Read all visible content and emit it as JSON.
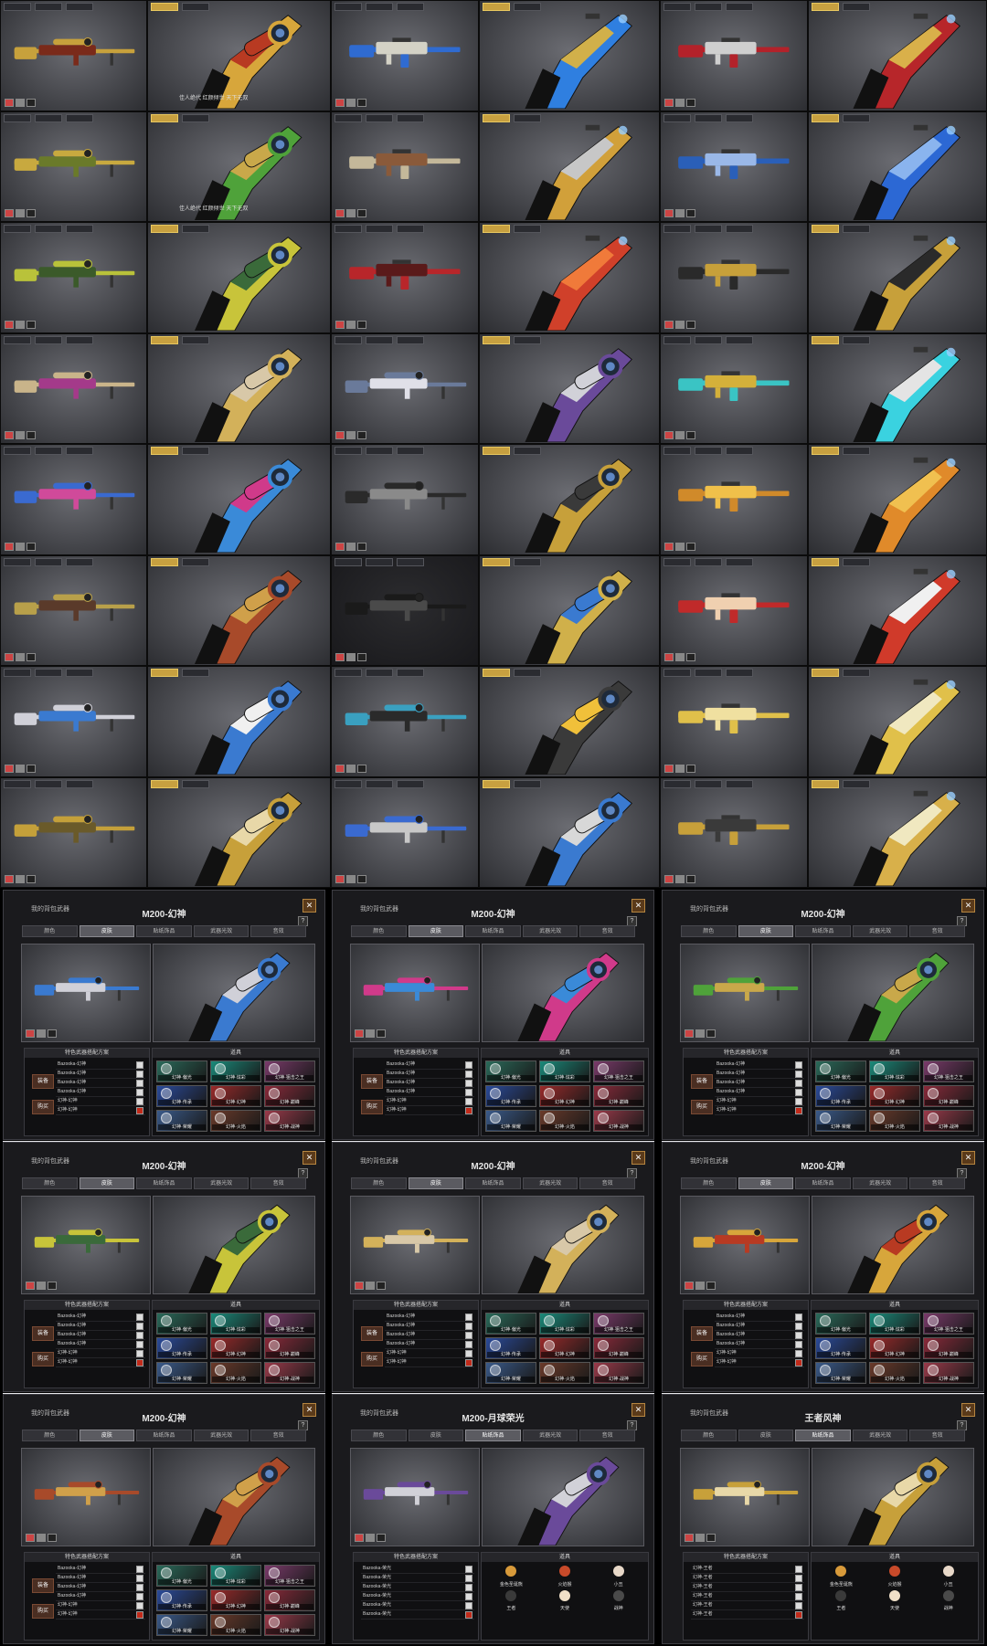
{
  "grid": {
    "cells": [
      {
        "view": "side",
        "mode": "ui",
        "c1": "#c7a13c",
        "c2": "#7a2a1a",
        "kind": "sniper",
        "tone": "light"
      },
      {
        "view": "fpv",
        "c1": "#d7a63b",
        "c2": "#b83a22",
        "kind": "sniper",
        "tone": "light",
        "caption": "佳人绝代 红颜倾世 天下无双"
      },
      {
        "view": "side",
        "mode": "ui",
        "c1": "#2f6bd1",
        "c2": "#d4d2c6",
        "kind": "rifle",
        "tone": "light"
      },
      {
        "view": "fpv",
        "c1": "#2f7fe0",
        "c2": "#d1b04a",
        "kind": "rifle",
        "tone": "light"
      },
      {
        "view": "side",
        "mode": "ui",
        "c1": "#b3222a",
        "c2": "#cfcfcf",
        "kind": "rifle",
        "tone": "light"
      },
      {
        "view": "fpv",
        "c1": "#b7262a",
        "c2": "#d9b04a",
        "kind": "rifle",
        "tone": "light"
      },
      {
        "view": "side",
        "mode": "ui",
        "c1": "#c8a93f",
        "c2": "#6a7a2a",
        "kind": "sniper",
        "tone": "light"
      },
      {
        "view": "fpv",
        "c1": "#4fa23a",
        "c2": "#c9a84a",
        "kind": "sniper",
        "tone": "light",
        "caption": "佳人绝代 红颜倾世 天下无双"
      },
      {
        "view": "side",
        "mode": "ui",
        "c1": "#c4b89a",
        "c2": "#8a5a3a",
        "kind": "rifle",
        "tone": "light"
      },
      {
        "view": "fpv",
        "c1": "#d1a03a",
        "c2": "#c7c7c7",
        "kind": "rifle",
        "tone": "light"
      },
      {
        "view": "side",
        "mode": "ui",
        "c1": "#2a5fb8",
        "c2": "#9ab8e8",
        "kind": "rifle",
        "tone": "light"
      },
      {
        "view": "fpv",
        "c1": "#2c68d4",
        "c2": "#8ab4ee",
        "kind": "rifle",
        "tone": "light"
      },
      {
        "view": "side",
        "mode": "ui",
        "c1": "#b9c23a",
        "c2": "#3b5a2a",
        "kind": "sniper",
        "tone": "light"
      },
      {
        "view": "fpv",
        "c1": "#c8c43a",
        "c2": "#3a6a3a",
        "kind": "sniper",
        "tone": "light"
      },
      {
        "view": "side",
        "mode": "ui",
        "c1": "#b8262a",
        "c2": "#5a1a1a",
        "kind": "rifle",
        "tone": "light"
      },
      {
        "view": "fpv",
        "c1": "#d0402a",
        "c2": "#f07a3a",
        "kind": "rifle",
        "tone": "light"
      },
      {
        "view": "side",
        "mode": "ui",
        "c1": "#2a2a2a",
        "c2": "#c7a03a",
        "kind": "rifle",
        "tone": "light"
      },
      {
        "view": "fpv",
        "c1": "#c7a03a",
        "c2": "#2a2a2a",
        "kind": "rifle",
        "tone": "light"
      },
      {
        "view": "side",
        "mode": "ui",
        "c1": "#c9b48a",
        "c2": "#a43a8a",
        "kind": "sniper",
        "tone": "light"
      },
      {
        "view": "fpv",
        "c1": "#d3b15a",
        "c2": "#d8c8a8",
        "kind": "sniper",
        "tone": "light"
      },
      {
        "view": "side",
        "mode": "ui",
        "c1": "#6a7a9a",
        "c2": "#e0e0e8",
        "kind": "sniper",
        "tone": "light"
      },
      {
        "view": "fpv",
        "c1": "#6a4a9a",
        "c2": "#d1d1d8",
        "kind": "sniper",
        "tone": "light"
      },
      {
        "view": "side",
        "mode": "ui",
        "c1": "#3ac4c4",
        "c2": "#d4b03a",
        "kind": "rifle",
        "tone": "light"
      },
      {
        "view": "fpv",
        "c1": "#3ad2e0",
        "c2": "#e4e4e4",
        "kind": "rifle",
        "tone": "light"
      },
      {
        "view": "side",
        "mode": "ui",
        "c1": "#3a6ad0",
        "c2": "#d04a9a",
        "kind": "sniper",
        "tone": "light"
      },
      {
        "view": "fpv",
        "c1": "#3a8ad8",
        "c2": "#d03a8a",
        "kind": "sniper",
        "tone": "light"
      },
      {
        "view": "side",
        "mode": "ui",
        "c1": "#2a2a2a",
        "c2": "#8a8a8a",
        "kind": "sniper",
        "tone": "light"
      },
      {
        "view": "fpv",
        "c1": "#c7a03a",
        "c2": "#3a3a3a",
        "kind": "sniper",
        "tone": "light"
      },
      {
        "view": "side",
        "mode": "ui",
        "c1": "#d08a2a",
        "c2": "#f0c04a",
        "kind": "rifle",
        "tone": "light"
      },
      {
        "view": "fpv",
        "c1": "#e08a2a",
        "c2": "#f0c050",
        "kind": "rifle",
        "tone": "light"
      },
      {
        "view": "side",
        "mode": "ui",
        "c1": "#b8a04a",
        "c2": "#5a3a2a",
        "kind": "sniper",
        "tone": "light"
      },
      {
        "view": "fpv",
        "c1": "#a84a2a",
        "c2": "#d0a04a",
        "kind": "sniper",
        "tone": "light"
      },
      {
        "view": "side",
        "mode": "ui",
        "c1": "#1a1a1a",
        "c2": "#4a4a4a",
        "kind": "sniper",
        "tone": "dark"
      },
      {
        "view": "fpv",
        "c1": "#d0b04a",
        "c2": "#3a7ad0",
        "kind": "sniper",
        "tone": "light"
      },
      {
        "view": "side",
        "mode": "ui",
        "c1": "#c02a2a",
        "c2": "#f0d0b0",
        "kind": "rifle",
        "tone": "light"
      },
      {
        "view": "fpv",
        "c1": "#d03a2a",
        "c2": "#f0f0f0",
        "kind": "rifle",
        "tone": "light"
      },
      {
        "view": "side",
        "mode": "ui",
        "c1": "#d0d0d8",
        "c2": "#3a7ad0",
        "kind": "sniper",
        "tone": "light"
      },
      {
        "view": "fpv",
        "c1": "#3a7ad0",
        "c2": "#f0f0f0",
        "kind": "sniper",
        "tone": "light"
      },
      {
        "view": "side",
        "mode": "ui",
        "c1": "#3aa0c0",
        "c2": "#2a2a2a",
        "kind": "sniper",
        "tone": "light"
      },
      {
        "view": "fpv",
        "c1": "#3a3a3a",
        "c2": "#f0c03a",
        "kind": "sniper",
        "tone": "light"
      },
      {
        "view": "side",
        "mode": "ui",
        "c1": "#e0c04a",
        "c2": "#f0e0a0",
        "kind": "rifle",
        "tone": "light"
      },
      {
        "view": "fpv",
        "c1": "#e0c04a",
        "c2": "#f0e8c0",
        "kind": "rifle",
        "tone": "light"
      },
      {
        "view": "side",
        "mode": "ui",
        "c1": "#c4a03a",
        "c2": "#6a5a2a",
        "kind": "sniper",
        "tone": "light"
      },
      {
        "view": "fpv",
        "c1": "#c7a03a",
        "c2": "#e8d8a8",
        "kind": "sniper",
        "tone": "light"
      },
      {
        "view": "side",
        "mode": "ui",
        "c1": "#3a6ad0",
        "c2": "#c8c8c8",
        "kind": "sniper",
        "tone": "light"
      },
      {
        "view": "fpv",
        "c1": "#3a7ad0",
        "c2": "#d8d8d8",
        "kind": "sniper",
        "tone": "light"
      },
      {
        "view": "side",
        "mode": "ui",
        "c1": "#c7a03a",
        "c2": "#3a3a3a",
        "kind": "rifle",
        "tone": "light"
      },
      {
        "view": "fpv",
        "c1": "#d8b04a",
        "c2": "#f0e8c0",
        "kind": "rifle",
        "tone": "light"
      }
    ]
  },
  "windows": [
    {
      "title": "M200-幻神",
      "sub": "我的背包武器",
      "tabs": [
        "颜色",
        "皮肤",
        "贴纸饰品",
        "武器光效",
        "音效"
      ],
      "active_tab": 1,
      "left_header": "特色武器搭配方案",
      "right_header": "道具",
      "left_btn1": "装备",
      "left_btn2": "购买",
      "rows": [
        "Bazooka-幻神",
        "Bazooka-幻神",
        "Bazooka-幻神",
        "Bazooka-幻神",
        "幻神-幻神",
        "幻神-幻神"
      ],
      "save": "保存",
      "cancel": "取消",
      "mode": "sprays",
      "c1": "#3a7ad0",
      "c2": "#d0d0d8"
    },
    {
      "title": "M200-幻神",
      "sub": "我的背包武器",
      "tabs": [
        "颜色",
        "皮肤",
        "贴纸饰品",
        "武器光效",
        "音效"
      ],
      "active_tab": 1,
      "left_header": "特色武器搭配方案",
      "right_header": "道具",
      "left_btn1": "装备",
      "left_btn2": "购买",
      "rows": [
        "Bazooka-幻神",
        "Bazooka-幻神",
        "Bazooka-幻神",
        "Bazooka-幻神",
        "幻神-幻神",
        "幻神-幻神"
      ],
      "save": "保存",
      "cancel": "取消",
      "mode": "sprays",
      "c1": "#d03a8a",
      "c2": "#3a8ad8"
    },
    {
      "title": "M200-幻神",
      "sub": "我的背包武器",
      "tabs": [
        "颜色",
        "皮肤",
        "贴纸饰品",
        "武器光效",
        "音效"
      ],
      "active_tab": 1,
      "left_header": "特色武器搭配方案",
      "right_header": "道具",
      "left_btn1": "装备",
      "left_btn2": "购买",
      "rows": [
        "Bazooka-幻神",
        "Bazooka-幻神",
        "Bazooka-幻神",
        "Bazooka-幻神",
        "幻神-幻神",
        "幻神-幻神"
      ],
      "save": "保存",
      "cancel": "取消",
      "mode": "sprays",
      "c1": "#4fa23a",
      "c2": "#c9a84a"
    },
    {
      "title": "M200-幻神",
      "sub": "我的背包武器",
      "tabs": [
        "颜色",
        "皮肤",
        "贴纸饰品",
        "武器光效",
        "音效"
      ],
      "active_tab": 1,
      "left_header": "特色武器搭配方案",
      "right_header": "道具",
      "left_btn1": "装备",
      "left_btn2": "购买",
      "rows": [
        "Bazooka-幻神",
        "Bazooka-幻神",
        "Bazooka-幻神",
        "Bazooka-幻神",
        "幻神-幻神",
        "幻神-幻神"
      ],
      "save": "保存",
      "cancel": "取消",
      "mode": "sprays",
      "c1": "#c8c43a",
      "c2": "#3a6a3a"
    },
    {
      "title": "M200-幻神",
      "sub": "我的背包武器",
      "tabs": [
        "颜色",
        "皮肤",
        "贴纸饰品",
        "武器光效",
        "音效"
      ],
      "active_tab": 1,
      "left_header": "特色武器搭配方案",
      "right_header": "道具",
      "left_btn1": "装备",
      "left_btn2": "购买",
      "rows": [
        "Bazooka-幻神",
        "Bazooka-幻神",
        "Bazooka-幻神",
        "Bazooka-幻神",
        "幻神-幻神",
        "幻神-幻神"
      ],
      "save": "保存",
      "cancel": "取消",
      "mode": "sprays",
      "c1": "#d3b15a",
      "c2": "#d8c8a8"
    },
    {
      "title": "M200-幻神",
      "sub": "我的背包武器",
      "tabs": [
        "颜色",
        "皮肤",
        "贴纸饰品",
        "武器光效",
        "音效"
      ],
      "active_tab": 1,
      "left_header": "特色武器搭配方案",
      "right_header": "道具",
      "left_btn1": "装备",
      "left_btn2": "购买",
      "rows": [
        "Bazooka-幻神",
        "Bazooka-幻神",
        "Bazooka-幻神",
        "Bazooka-幻神",
        "幻神-幻神",
        "幻神-幻神"
      ],
      "save": "保存",
      "cancel": "取消",
      "mode": "sprays",
      "c1": "#d7a63b",
      "c2": "#b83a22"
    },
    {
      "title": "M200-幻神",
      "sub": "我的背包武器",
      "tabs": [
        "颜色",
        "皮肤",
        "贴纸饰品",
        "武器光效",
        "音效"
      ],
      "active_tab": 1,
      "left_header": "特色武器搭配方案",
      "right_header": "道具",
      "left_btn1": "装备",
      "left_btn2": "购买",
      "rows": [
        "Bazooka-幻神",
        "Bazooka-幻神",
        "Bazooka-幻神",
        "Bazooka-幻神",
        "幻神-幻神",
        "幻神-幻神"
      ],
      "save": "保存",
      "cancel": "取消",
      "mode": "sprays",
      "c1": "#a84a2a",
      "c2": "#d0a04a"
    },
    {
      "title": "M200-月球荣光",
      "sub": "我的背包武器",
      "tabs": [
        "颜色",
        "皮肤",
        "贴纸饰品",
        "武器光效",
        "音效"
      ],
      "active_tab": 2,
      "left_header": "特色武器搭配方案",
      "right_header": "道具",
      "left_btn1": "",
      "left_btn2": "",
      "rows": [
        "Bazooka-荣光",
        "Bazooka-荣光",
        "Bazooka-荣光",
        "Bazooka-荣光",
        "Bazooka-荣光",
        "Bazooka-荣光"
      ],
      "save": "保存",
      "cancel": "取消",
      "mode": "charms",
      "c1": "#6a4a9a",
      "c2": "#d1d1d8"
    },
    {
      "title": "王者风神",
      "sub": "我的背包武器",
      "tabs": [
        "颜色",
        "皮肤",
        "贴纸饰品",
        "武器光效",
        "音效"
      ],
      "active_tab": 2,
      "left_header": "特色武器搭配方案",
      "right_header": "道具",
      "left_btn1": "",
      "left_btn2": "",
      "rows": [
        "幻神-王者",
        "幻神-王者",
        "幻神-王者",
        "幻神-王者",
        "幻神-王者",
        "幻神-王者"
      ],
      "save": "保存",
      "cancel": "取消",
      "mode": "charms",
      "c1": "#c7a03a",
      "c2": "#e8d8a8"
    }
  ],
  "sprays": [
    "幻神·偏光",
    "幻神·炫彩",
    "幻神·狙击之王",
    "幻神·传承",
    "幻神·幻神",
    "幻神·巅峰",
    "幻神·荣耀",
    "幻神·火焰",
    "幻神·战神"
  ],
  "charms": [
    "金色圣诞熊",
    "火焰猴",
    "小丑",
    "王者",
    "天使",
    "战神"
  ]
}
